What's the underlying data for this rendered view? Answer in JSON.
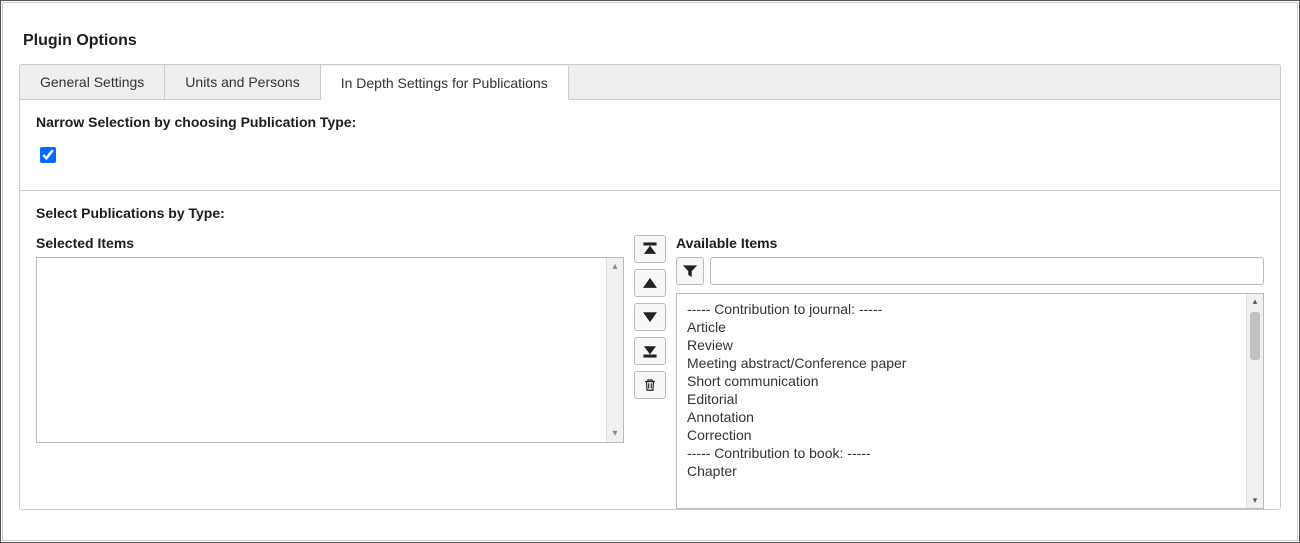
{
  "page": {
    "title": "Plugin Options"
  },
  "tabs": [
    {
      "label": "General Settings"
    },
    {
      "label": "Units and Persons"
    },
    {
      "label": "In Depth Settings for Publications"
    }
  ],
  "narrow": {
    "label": "Narrow Selection by choosing Publication Type:",
    "checked": true
  },
  "select": {
    "label": "Select Publications by Type:",
    "selected_title": "Selected Items",
    "available_title": "Available Items",
    "filter_placeholder": "",
    "available": [
      "----- Contribution to journal: -----",
      "Article",
      "Review",
      "Meeting abstract/Conference paper",
      "Short communication",
      "Editorial",
      "Annotation",
      "Correction",
      "----- Contribution to book: -----",
      "Chapter"
    ]
  },
  "buttons": {
    "move_top": "Move to top",
    "move_up": "Move up",
    "move_down": "Move down",
    "move_bottom": "Move to bottom",
    "remove": "Remove",
    "filter": "Filter"
  }
}
